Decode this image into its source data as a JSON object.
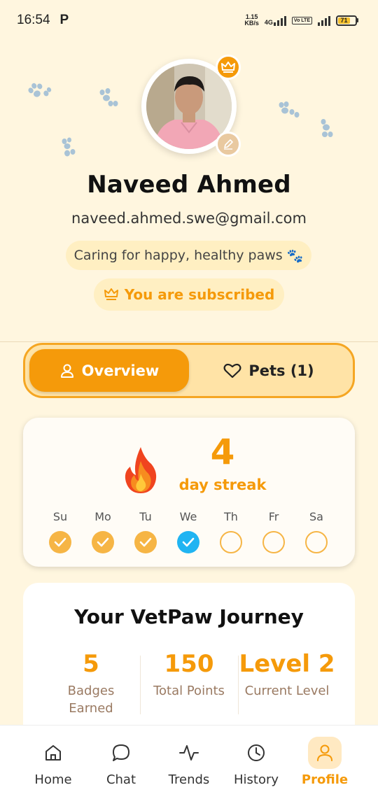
{
  "status_bar": {
    "time": "16:54",
    "app_indicator": "P",
    "net_speed_value": "1.15",
    "net_speed_unit": "KB/s",
    "network_type": "4G",
    "volte_label": "Vo LTE",
    "battery_level": "71"
  },
  "profile": {
    "name": "Naveed Ahmed",
    "email": "naveed.ahmed.swe@gmail.com",
    "bio": "Caring for happy, healthy paws",
    "bio_emoji": "🐾",
    "subscription": "You are subscribed"
  },
  "tabs": [
    {
      "label": "Overview",
      "icon": "person-icon",
      "active": true
    },
    {
      "label": "Pets (1)",
      "icon": "heart-icon",
      "active": false
    }
  ],
  "streak": {
    "count": "4",
    "label": "day streak",
    "days": [
      {
        "label": "Su",
        "state": "done"
      },
      {
        "label": "Mo",
        "state": "done"
      },
      {
        "label": "Tu",
        "state": "done"
      },
      {
        "label": "We",
        "state": "today"
      },
      {
        "label": "Th",
        "state": "empty"
      },
      {
        "label": "Fr",
        "state": "empty"
      },
      {
        "label": "Sa",
        "state": "empty"
      }
    ]
  },
  "journey": {
    "title": "Your VetPaw Journey",
    "stats": [
      {
        "value": "5",
        "label": "Badges Earned"
      },
      {
        "value": "150",
        "label": "Total Points"
      },
      {
        "value": "Level 2",
        "label": "Current Level"
      }
    ]
  },
  "nav": {
    "items": [
      {
        "label": "Home",
        "icon": "home-icon"
      },
      {
        "label": "Chat",
        "icon": "chat-icon"
      },
      {
        "label": "Trends",
        "icon": "trends-icon"
      },
      {
        "label": "History",
        "icon": "history-icon"
      },
      {
        "label": "Profile",
        "icon": "profile-icon",
        "active": true
      }
    ]
  },
  "colors": {
    "accent": "#F59A0A",
    "background": "#FFF6DF",
    "today": "#20B4F2"
  }
}
